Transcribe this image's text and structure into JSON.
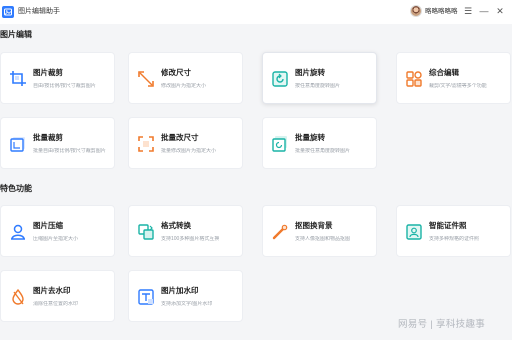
{
  "app": {
    "title": "图片编辑助手"
  },
  "user": {
    "name": "略略略略略"
  },
  "window_controls": {
    "menu": "☰",
    "minimize": "—",
    "close": "✕"
  },
  "sections": [
    {
      "title": "图片编辑",
      "cards": [
        {
          "name": "图片裁剪",
          "desc": "自由/按比例/按尺寸裁剪图片",
          "icon": "crop-icon"
        },
        {
          "name": "修改尺寸",
          "desc": "修改图片为指定大小",
          "icon": "resize-icon"
        },
        {
          "name": "图片旋转",
          "desc": "按任意角度旋转图片",
          "icon": "rotate-icon"
        },
        {
          "name": "综合编辑",
          "desc": "裁剪/文字/滤镜等多个功能",
          "icon": "grid-edit-icon"
        },
        {
          "name": "批量裁剪",
          "desc": "批量自由/按比例/按尺寸裁剪图片",
          "icon": "batch-crop-icon"
        },
        {
          "name": "批量改尺寸",
          "desc": "批量修改图片为指定大小",
          "icon": "batch-resize-icon"
        },
        {
          "name": "批量旋转",
          "desc": "批量按任意角度旋转图片",
          "icon": "batch-rotate-icon"
        }
      ]
    },
    {
      "title": "特色功能",
      "cards": [
        {
          "name": "图片压缩",
          "desc": "压缩图片至指定大小",
          "icon": "compress-icon"
        },
        {
          "name": "格式转换",
          "desc": "支持100多种图片格式互换",
          "icon": "convert-icon"
        },
        {
          "name": "抠图换背景",
          "desc": "支持人像抠图和物品抠图",
          "icon": "cutout-icon"
        },
        {
          "name": "智能证件照",
          "desc": "支持多种规格的证件照",
          "icon": "id-photo-icon"
        },
        {
          "name": "图片去水印",
          "desc": "消除任意位置的水印",
          "icon": "remove-watermark-icon"
        },
        {
          "name": "图片加水印",
          "desc": "支持添加文字/图片水印",
          "icon": "add-watermark-icon"
        }
      ]
    }
  ],
  "watermark": "网易号 | 享科技趣事",
  "colors": {
    "accent": "#2f7bff",
    "teal": "#19b3a6",
    "orange": "#f07a2c"
  }
}
